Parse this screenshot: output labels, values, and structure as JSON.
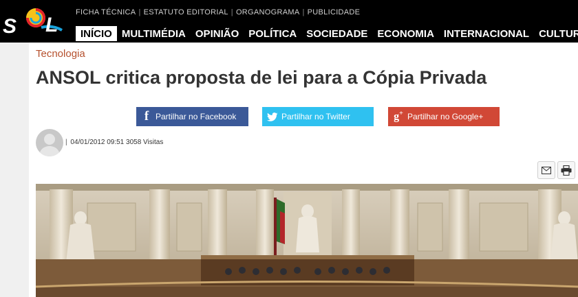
{
  "header": {
    "logo_text": "SOL",
    "top_links": [
      "FICHA TÉCNICA",
      "ESTATUTO EDITORIAL",
      "ORGANOGRAMA",
      "PUBLICIDADE"
    ],
    "nav": [
      "INÍCIO",
      "MULTIMÉDIA",
      "OPINIÃO",
      "POLÍTICA",
      "SOCIEDADE",
      "ECONOMIA",
      "INTERNACIONAL",
      "CULTURA"
    ],
    "active_nav": "INÍCIO"
  },
  "article": {
    "category": "Tecnologia",
    "title": "ANSOL critica proposta de lei para a Cópia Privada",
    "share": {
      "facebook": "Partilhar no Facebook",
      "twitter": "Partilhar no Twitter",
      "google": "Partilhar no Google+"
    },
    "meta": {
      "datetime": "04/01/2012 09:51",
      "visits": "3058 Visitas"
    },
    "icons": {
      "email": "envelope-icon",
      "print": "printer-icon"
    }
  },
  "colors": {
    "header_bg": "#000000",
    "category": "#b5502d",
    "facebook": "#3b5998",
    "twitter": "#2fc1f0",
    "google": "#d14836"
  }
}
